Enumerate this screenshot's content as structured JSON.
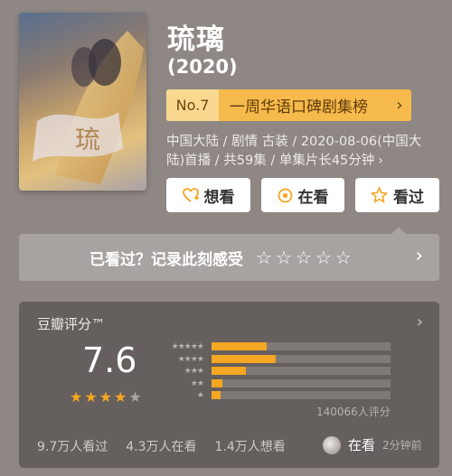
{
  "poster": {
    "alt": "琉璃"
  },
  "title": "琉璃",
  "year": "(2020)",
  "rank": {
    "no": "No.7",
    "name": "一周华语口碑剧集榜",
    "arrow": "›"
  },
  "meta": {
    "text": "中国大陆 / 剧情 古装 / 2020-08-06(中国大陆)首播 / 共59集 / 单集片长45分钟",
    "chevron": "›"
  },
  "actions": {
    "want": {
      "label": "想看",
      "icon": "heart-plus-icon"
    },
    "watching": {
      "label": "在看",
      "icon": "target-icon"
    },
    "watched": {
      "label": "看过",
      "icon": "star-outline-icon"
    }
  },
  "review": {
    "label": "已看过？记录此刻感受",
    "stars": [
      "☆",
      "☆",
      "☆",
      "☆",
      "☆"
    ],
    "arrow": "›"
  },
  "rating": {
    "label": "豆瓣评分™",
    "arrow": "›",
    "score": "7.6",
    "stars_filled": 4,
    "star_colors": {
      "filled": "#f5a623",
      "empty": "#aaa39f"
    },
    "histogram_stars": [
      "★★★★★",
      "★★★★",
      "★★★",
      "★★",
      "★"
    ],
    "distribution": [
      0.31,
      0.36,
      0.19,
      0.06,
      0.05
    ],
    "votes": "140066人评分",
    "stats": [
      "9.7万人看过",
      "4.3万人在看",
      "1.4万人想看"
    ],
    "friend": {
      "status": "在看",
      "time": "2分钟前"
    }
  },
  "colors": {
    "accent": "#f5a623",
    "rank_bg": "#f6b94b",
    "background": "#8e8784",
    "card": "#655f5d"
  }
}
